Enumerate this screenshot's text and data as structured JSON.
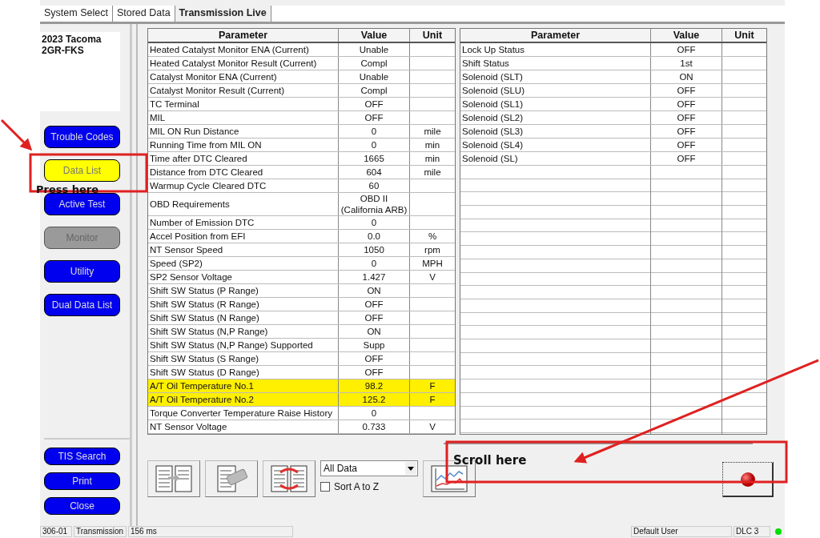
{
  "tabs": [
    {
      "label": "System Select",
      "selected": false
    },
    {
      "label": "Stored Data",
      "selected": false
    },
    {
      "label": "Transmission Live",
      "selected": true
    }
  ],
  "vehicle": {
    "model": "2023 Tacoma",
    "engine": "2GR-FKS"
  },
  "side_buttons": [
    {
      "label": "Trouble Codes",
      "selected": false,
      "disabled": false
    },
    {
      "label": "Data List",
      "selected": true,
      "disabled": false
    },
    {
      "label": "Active Test",
      "selected": false,
      "disabled": false
    },
    {
      "label": "Monitor",
      "selected": false,
      "disabled": true
    },
    {
      "label": "Utility",
      "selected": false,
      "disabled": false
    },
    {
      "label": "Dual Data List",
      "selected": false,
      "disabled": false
    }
  ],
  "bottom_buttons": [
    "TIS Search",
    "Print",
    "Close"
  ],
  "left_table": {
    "columns": [
      "Parameter",
      "Value",
      "Unit"
    ],
    "rows": [
      {
        "parameter": "Heated Catalyst Monitor ENA (Current)",
        "value": "Unable",
        "unit": "",
        "highlighted": false
      },
      {
        "parameter": "Heated Catalyst Monitor Result (Current)",
        "value": "Compl",
        "unit": "",
        "highlighted": false
      },
      {
        "parameter": "Catalyst Monitor ENA (Current)",
        "value": "Unable",
        "unit": "",
        "highlighted": false
      },
      {
        "parameter": "Catalyst Monitor Result (Current)",
        "value": "Compl",
        "unit": "",
        "highlighted": false
      },
      {
        "parameter": "TC Terminal",
        "value": "OFF",
        "unit": "",
        "highlighted": false
      },
      {
        "parameter": "MIL",
        "value": "OFF",
        "unit": "",
        "highlighted": false
      },
      {
        "parameter": "MIL ON Run Distance",
        "value": "0",
        "unit": "mile",
        "highlighted": false
      },
      {
        "parameter": "Running Time from MIL ON",
        "value": "0",
        "unit": "min",
        "highlighted": false
      },
      {
        "parameter": "Time after DTC Cleared",
        "value": "1665",
        "unit": "min",
        "highlighted": false
      },
      {
        "parameter": "Distance from DTC Cleared",
        "value": "604",
        "unit": "mile",
        "highlighted": false
      },
      {
        "parameter": "Warmup Cycle Cleared DTC",
        "value": "60",
        "unit": "",
        "highlighted": false
      },
      {
        "parameter": "OBD Requirements",
        "value": "OBD II (California ARB)",
        "unit": "",
        "highlighted": false
      },
      {
        "parameter": "Number of Emission DTC",
        "value": "0",
        "unit": "",
        "highlighted": false
      },
      {
        "parameter": "Accel Position from EFI",
        "value": "0.0",
        "unit": "%",
        "highlighted": false
      },
      {
        "parameter": "NT Sensor Speed",
        "value": "1050",
        "unit": "rpm",
        "highlighted": false
      },
      {
        "parameter": "Speed (SP2)",
        "value": "0",
        "unit": "MPH",
        "highlighted": false
      },
      {
        "parameter": "SP2 Sensor Voltage",
        "value": "1.427",
        "unit": "V",
        "highlighted": false
      },
      {
        "parameter": "Shift SW Status (P Range)",
        "value": "ON",
        "unit": "",
        "highlighted": false
      },
      {
        "parameter": "Shift SW Status (R Range)",
        "value": "OFF",
        "unit": "",
        "highlighted": false
      },
      {
        "parameter": "Shift SW Status (N Range)",
        "value": "OFF",
        "unit": "",
        "highlighted": false
      },
      {
        "parameter": "Shift SW Status (N,P Range)",
        "value": "ON",
        "unit": "",
        "highlighted": false
      },
      {
        "parameter": "Shift SW Status (N,P Range) Supported",
        "value": "Supp",
        "unit": "",
        "highlighted": false
      },
      {
        "parameter": "Shift SW Status (S Range)",
        "value": "OFF",
        "unit": "",
        "highlighted": false
      },
      {
        "parameter": "Shift SW Status (D Range)",
        "value": "OFF",
        "unit": "",
        "highlighted": false
      },
      {
        "parameter": "A/T Oil Temperature No.1",
        "value": "98.2",
        "unit": "F",
        "highlighted": true
      },
      {
        "parameter": "A/T Oil Temperature No.2",
        "value": "125.2",
        "unit": "F",
        "highlighted": true
      },
      {
        "parameter": "Torque Converter Temperature Raise History",
        "value": "0",
        "unit": "",
        "highlighted": false
      },
      {
        "parameter": "NT Sensor Voltage",
        "value": "0.733",
        "unit": "V",
        "highlighted": false
      }
    ]
  },
  "right_table": {
    "columns": [
      "Parameter",
      "Value",
      "Unit"
    ],
    "rows": [
      {
        "parameter": "Lock Up Status",
        "value": "OFF"
      },
      {
        "parameter": "Shift Status",
        "value": "1st"
      },
      {
        "parameter": "Solenoid (SLT)",
        "value": "ON"
      },
      {
        "parameter": "Solenoid (SLU)",
        "value": "OFF"
      },
      {
        "parameter": "Solenoid (SL1)",
        "value": "OFF"
      },
      {
        "parameter": "Solenoid (SL2)",
        "value": "OFF"
      },
      {
        "parameter": "Solenoid (SL3)",
        "value": "OFF"
      },
      {
        "parameter": "Solenoid (SL4)",
        "value": "OFF"
      },
      {
        "parameter": "Solenoid (SL)",
        "value": "OFF"
      }
    ]
  },
  "toolbar": {
    "dropdown": "All Data",
    "sort_checkbox": {
      "label": "Sort A to Z",
      "checked": false
    }
  },
  "status_bar": [
    "306-01",
    "Transmission",
    "156 ms",
    "Default User",
    "DLC 3"
  ],
  "connection": {
    "on": true
  },
  "annotations": [
    "Press here",
    "Scroll here"
  ]
}
